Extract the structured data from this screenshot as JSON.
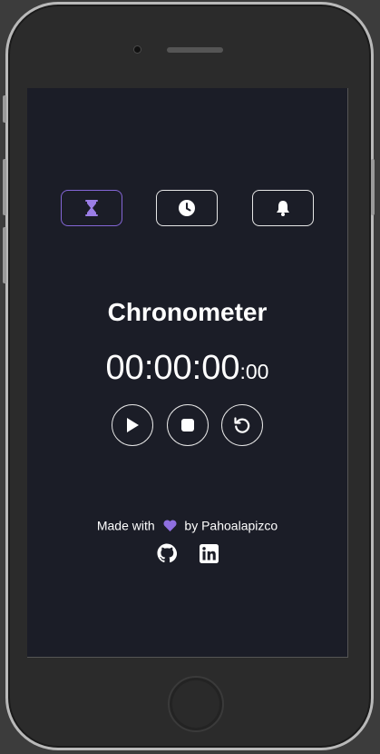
{
  "app": {
    "title": "Chronometer",
    "time_main": "00:00:00",
    "time_centis": ":00"
  },
  "tabs": [
    {
      "icon": "hourglass-icon",
      "active": true
    },
    {
      "icon": "clock-icon",
      "active": false
    },
    {
      "icon": "bell-icon",
      "active": false
    }
  ],
  "controls": [
    {
      "icon": "play-icon"
    },
    {
      "icon": "stop-icon"
    },
    {
      "icon": "reset-icon"
    }
  ],
  "footer": {
    "made_with": "Made with",
    "by_author": "by Pahoalapizco",
    "heart_icon": "heart-icon",
    "links": [
      {
        "icon": "github-icon"
      },
      {
        "icon": "linkedin-icon"
      }
    ]
  },
  "colors": {
    "accent": "#8466d6",
    "background": "#1b1d27",
    "text": "#ffffff"
  }
}
